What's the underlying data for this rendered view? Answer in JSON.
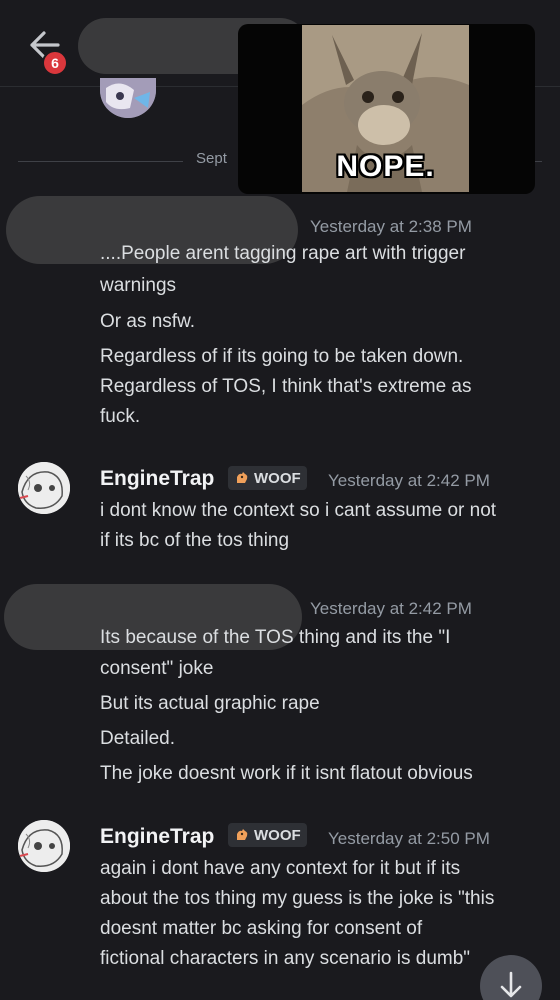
{
  "header": {
    "back_label": "back",
    "notification_count": "6"
  },
  "date_divider": {
    "text": "Sept"
  },
  "gif": {
    "caption": "NOPE."
  },
  "messages": [
    {
      "timestamp": "Yesterday at 2:38 PM",
      "lines": [
        "....People arent tagging rape art with trigger",
        "warnings",
        "Or as nsfw.",
        "Regardless of if its going to be taken down.",
        "Regardless of TOS, I think that's extreme as",
        "fuck."
      ]
    },
    {
      "username": "EngineTrap",
      "role": "WOOF",
      "timestamp": "Yesterday at 2:42 PM",
      "lines": [
        "i dont know the context so i cant assume or not",
        "if its bc of the tos thing"
      ]
    },
    {
      "timestamp": "Yesterday at 2:42 PM",
      "lines": [
        "Its because of the TOS thing and its the \"I",
        "consent\" joke",
        "But its actual graphic rape",
        "Detailed.",
        "The joke doesnt work if it isnt flatout obvious"
      ]
    },
    {
      "username": "EngineTrap",
      "role": "WOOF",
      "timestamp": "Yesterday at 2:50 PM",
      "lines": [
        "again i dont have any context for it but if its",
        "about the tos thing my guess is the joke is \"this",
        "doesnt matter bc asking for consent of",
        "fictional characters in any scenario is dumb\""
      ]
    }
  ],
  "colors": {
    "background": "#1a1a1e",
    "text": "#dbdee1",
    "muted": "#949ba4",
    "badge": "#da373c",
    "role_tag_bg": "#2e3035"
  },
  "icons": {
    "back": "arrow-left-icon",
    "role": "woof-role-icon",
    "scroll": "arrow-down-icon"
  }
}
